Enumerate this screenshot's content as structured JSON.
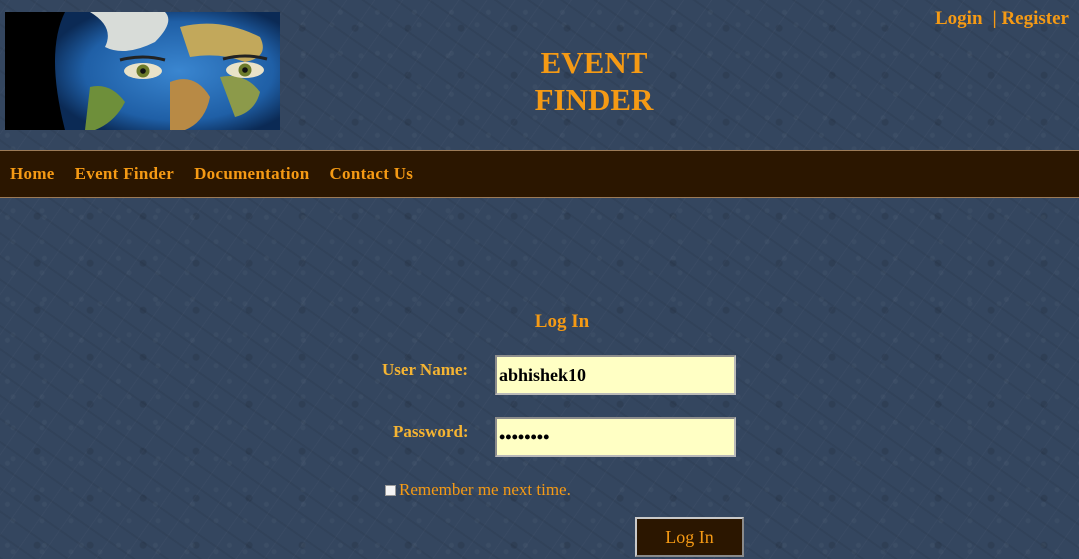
{
  "header": {
    "title_line1": "EVENT",
    "title_line2": "FINDER",
    "login_link": "Login",
    "register_link": "| Register"
  },
  "nav": {
    "items": [
      {
        "label": "Home"
      },
      {
        "label": "Event Finder"
      },
      {
        "label": "Documentation"
      },
      {
        "label": "Contact Us"
      }
    ]
  },
  "login_form": {
    "title": "Log In",
    "username_label": "User Name:",
    "username_value": "abhishek10",
    "password_label": "Password:",
    "password_value": "••••••••",
    "remember_label": "Remember me next time.",
    "remember_checked": false,
    "submit_label": "Log In"
  },
  "colors": {
    "background": "#34465f",
    "accent": "#f59a14",
    "navbar": "#2b1600",
    "input_bg": "#ffffc4"
  }
}
